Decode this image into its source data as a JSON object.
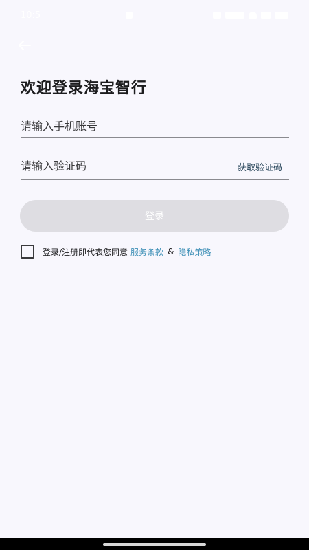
{
  "status_bar": {
    "time": "10:5",
    "right_text": "",
    "battery": ""
  },
  "header": {
    "back_icon": "arrow-left-icon"
  },
  "login": {
    "title": "欢迎登录海宝智行",
    "phone_placeholder": "请输入手机账号",
    "code_placeholder": "请输入验证码",
    "get_code_label": "获取验证码",
    "login_label": "登录"
  },
  "agreement": {
    "prefix": "登录/注册即代表您同意",
    "terms_label": "服务条款",
    "ampersand": "&",
    "privacy_label": "隐私策略"
  },
  "colors": {
    "background": "#f8f7fd",
    "button_disabled": "#dedde2",
    "link": "#3d8fb6",
    "text": "#1c1c1e"
  }
}
